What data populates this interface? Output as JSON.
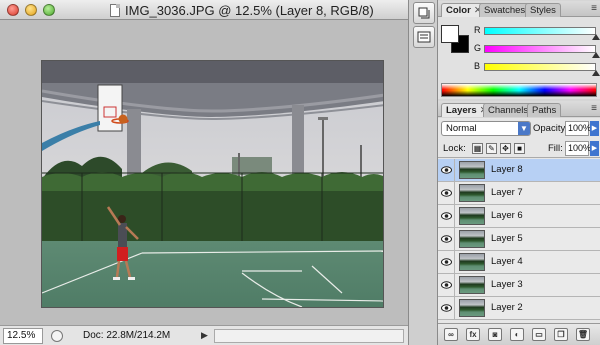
{
  "document": {
    "title": "IMG_3036.JPG @ 12.5% (Layer 8, RGB/8)"
  },
  "status_bar": {
    "zoom": "12.5%",
    "doc_size": "Doc: 22.8M/214.2M"
  },
  "color_panel": {
    "tabs": [
      {
        "label": "Color",
        "close": "✕",
        "active": true
      },
      {
        "label": "Swatches",
        "close": "",
        "active": false
      },
      {
        "label": "Styles",
        "close": "",
        "active": false
      }
    ],
    "foreground": "#ffffff",
    "background": "#000000",
    "sliders": [
      {
        "label": "R",
        "value": "255",
        "track_color": "#00e5ff"
      },
      {
        "label": "G",
        "value": "255",
        "track_color": "#ff33cc"
      },
      {
        "label": "B",
        "value": "255",
        "track_color": "#f2ee22"
      }
    ]
  },
  "layers_panel": {
    "tabs": [
      {
        "label": "Layers",
        "close": "✕",
        "active": true
      },
      {
        "label": "Channels",
        "close": "",
        "active": false
      },
      {
        "label": "Paths",
        "close": "",
        "active": false
      }
    ],
    "blend_mode": "Normal",
    "opacity_label": "Opacity:",
    "opacity": "100%",
    "lock_label": "Lock:",
    "fill_label": "Fill:",
    "fill": "100%",
    "layers": [
      {
        "name": "Layer 8",
        "selected": true
      },
      {
        "name": "Layer 7",
        "selected": false
      },
      {
        "name": "Layer 6",
        "selected": false
      },
      {
        "name": "Layer 5",
        "selected": false
      },
      {
        "name": "Layer 4",
        "selected": false
      },
      {
        "name": "Layer 3",
        "selected": false
      },
      {
        "name": "Layer 2",
        "selected": false
      }
    ],
    "footer_icons": [
      "link-layers-icon",
      "fx-icon",
      "mask-icon",
      "adjustment-icon",
      "group-icon",
      "new-layer-icon",
      "trash-icon"
    ],
    "selection_color": "#b7d0f4"
  }
}
